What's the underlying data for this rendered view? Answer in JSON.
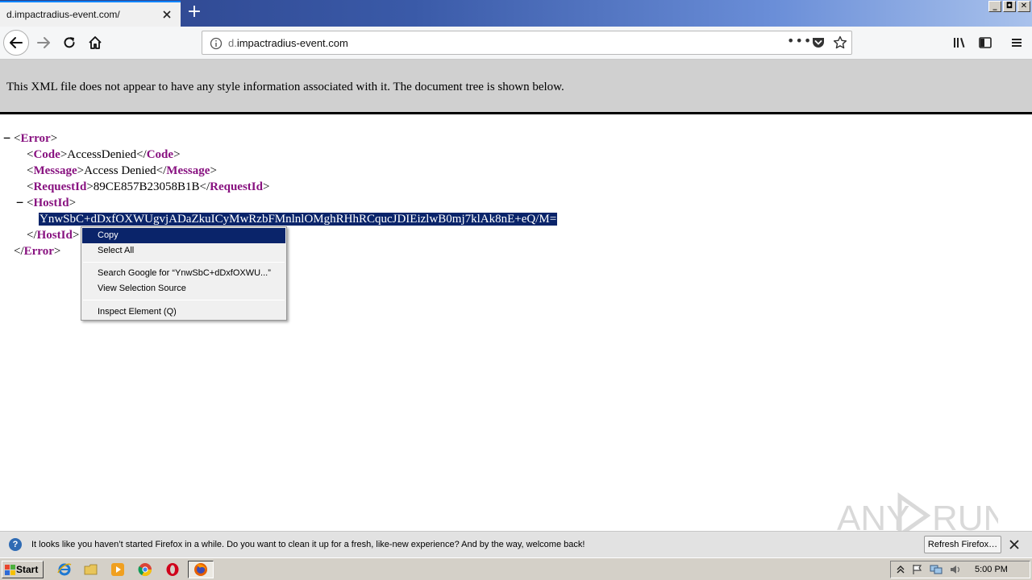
{
  "browser": {
    "tab_title": "d.impactradius-event.com/",
    "url_prefix": "d.",
    "url_domain": "impactradius-event.com",
    "url_more": "•••",
    "new_tab": "+"
  },
  "xml": {
    "header_message": "This XML file does not appear to have any style information associated with it. The document tree is shown below.",
    "fold_open": "−",
    "root_tag": "Error",
    "code_tag": "Code",
    "code_value": "AccessDenied",
    "message_tag": "Message",
    "message_value": "Access Denied",
    "requestid_tag": "RequestId",
    "requestid_value": "89CE857B23058B1B",
    "hostid_tag": "HostId",
    "hostid_value": "YnwSbC+dDxfOXWUgvjADaZkuICyMwRzbFMnlnlOMghRHhRCqucJDIEizlwB0mj7klAk8nE+eQ/M="
  },
  "context_menu": {
    "copy": "Copy",
    "select_all": "Select All",
    "search_google": "Search Google for “YnwSbC+dDxfOXWU...”",
    "view_selection_source": "View Selection Source",
    "inspect_element": "Inspect Element (Q)"
  },
  "notification": {
    "message": "It looks like you haven’t started Firefox in a while. Do you want to clean it up for a fresh, like-new experience? And by the way, welcome back!",
    "button": "Refresh Firefox…",
    "info_glyph": "?"
  },
  "taskbar": {
    "start": "Start",
    "clock": "5:00 PM"
  },
  "watermark": {
    "text": "ANY RUN"
  },
  "colors": {
    "tag": "#881280",
    "selection": "#0a246a",
    "header_bg": "#d0d0d0"
  }
}
